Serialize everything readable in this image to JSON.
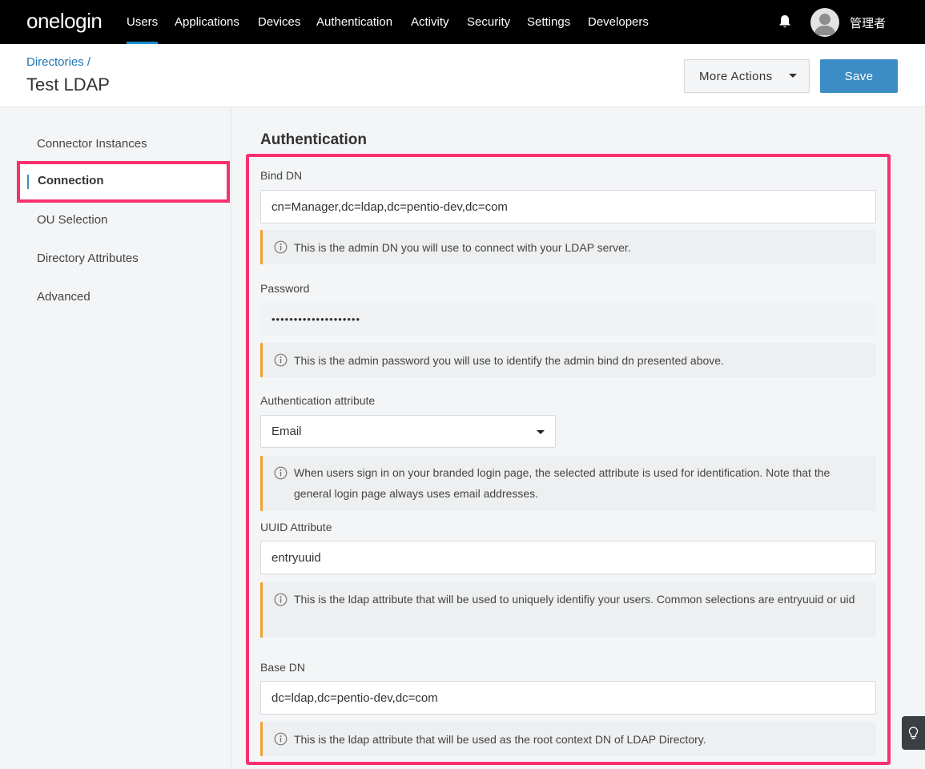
{
  "brand": {
    "logo": "onelogin"
  },
  "nav": {
    "items": [
      {
        "label": "Users",
        "active": true
      },
      {
        "label": "Applications"
      },
      {
        "label": "Devices"
      },
      {
        "label": "Authentication"
      },
      {
        "label": "Activity"
      },
      {
        "label": "Security"
      },
      {
        "label": "Settings"
      },
      {
        "label": "Developers"
      }
    ],
    "user_name": "管理者"
  },
  "header": {
    "breadcrumb": "Directories /",
    "title": "Test LDAP",
    "more_actions_label": "More Actions",
    "save_label": "Save"
  },
  "sidebar": {
    "items": [
      {
        "label": "Connector Instances"
      },
      {
        "label": "Connection",
        "active": true
      },
      {
        "label": "OU Selection"
      },
      {
        "label": "Directory Attributes"
      },
      {
        "label": "Advanced"
      }
    ]
  },
  "main": {
    "section_title": "Authentication",
    "fields": {
      "bind_dn": {
        "label": "Bind DN",
        "value": "cn=Manager,dc=ldap,dc=pentio-dev,dc=com",
        "hint": "This is the admin DN you will use to connect with your LDAP server."
      },
      "password": {
        "label": "Password",
        "value": "••••••••••••••••••••",
        "hint": "This is the admin password you will use to identify the admin bind dn presented above."
      },
      "auth_attribute": {
        "label": "Authentication attribute",
        "value": "Email",
        "hint": "When users sign in on your branded login page, the selected attribute is used for identification. Note that the general login page always uses email addresses."
      },
      "uuid_attribute": {
        "label": "UUID Attribute",
        "value": "entryuuid",
        "hint": "This is the ldap attribute that will be used to uniquely identifiy your users. Common selections are entryuuid or uid"
      },
      "base_dn": {
        "label": "Base DN",
        "value": "dc=ldap,dc=pentio-dev,dc=com",
        "hint": "This is the ldap attribute that will be used as the root context DN of LDAP Directory."
      }
    }
  },
  "colors": {
    "highlight": "#f7316e",
    "accent": "#3c8dc6",
    "hint_border": "#f0a22f"
  }
}
